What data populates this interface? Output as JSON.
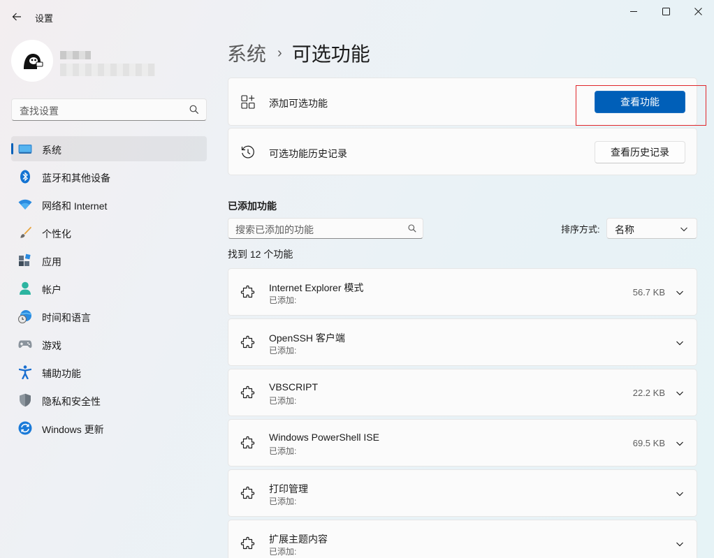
{
  "window": {
    "title": "设置"
  },
  "sidebar": {
    "search_placeholder": "查找设置",
    "items": [
      {
        "label": "系统",
        "icon": "system-display-icon"
      },
      {
        "label": "蓝牙和其他设备",
        "icon": "bluetooth-icon"
      },
      {
        "label": "网络和 Internet",
        "icon": "wifi-icon"
      },
      {
        "label": "个性化",
        "icon": "paintbrush-icon"
      },
      {
        "label": "应用",
        "icon": "apps-icon"
      },
      {
        "label": "帐户",
        "icon": "account-icon"
      },
      {
        "label": "时间和语言",
        "icon": "globe-clock-icon"
      },
      {
        "label": "游戏",
        "icon": "gamepad-icon"
      },
      {
        "label": "辅助功能",
        "icon": "accessibility-icon"
      },
      {
        "label": "隐私和安全性",
        "icon": "shield-icon"
      },
      {
        "label": "Windows 更新",
        "icon": "windows-update-icon"
      }
    ],
    "selected_index": 0
  },
  "breadcrumb": {
    "parent": "系统",
    "separator": "›",
    "current": "可选功能"
  },
  "add_card": {
    "title": "添加可选功能",
    "button": "查看功能"
  },
  "history_card": {
    "title": "可选功能历史记录",
    "button": "查看历史记录"
  },
  "added_section": {
    "title": "已添加功能",
    "search_placeholder": "搜索已添加的功能",
    "sort_label": "排序方式:",
    "sort_value": "名称",
    "found_text": "找到 12 个功能"
  },
  "features": [
    {
      "name": "Internet Explorer 模式",
      "status": "已添加:",
      "size": "56.7 KB"
    },
    {
      "name": "OpenSSH 客户端",
      "status": "已添加:",
      "size": ""
    },
    {
      "name": "VBSCRIPT",
      "status": "已添加:",
      "size": "22.2 KB"
    },
    {
      "name": "Windows PowerShell ISE",
      "status": "已添加:",
      "size": "69.5 KB"
    },
    {
      "name": "打印管理",
      "status": "已添加:",
      "size": ""
    },
    {
      "name": "扩展主题内容",
      "status": "已添加:",
      "size": ""
    }
  ],
  "colors": {
    "accent": "#005fb8",
    "highlight_box": "#e0272b"
  }
}
